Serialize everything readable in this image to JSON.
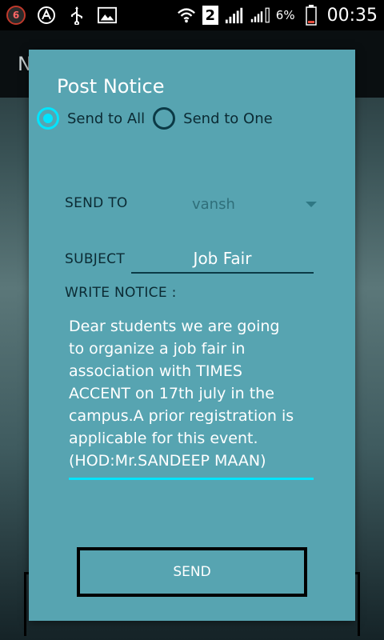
{
  "status_bar": {
    "notification_count": "6",
    "sim_number": "2",
    "battery_percent": "6%",
    "time": "00:35",
    "icons": [
      "notification-badge",
      "a-logo-icon",
      "usb-icon",
      "image-icon",
      "wifi-icon",
      "sim-icon",
      "signal-icon",
      "signal-icon",
      "battery-icon"
    ]
  },
  "background_app": {
    "title_initial": "N"
  },
  "dialog": {
    "title": "Post Notice",
    "radio_options": [
      {
        "label": "Send to All",
        "selected": true
      },
      {
        "label": "Send to One",
        "selected": false
      }
    ],
    "send_to_label": "SEND TO",
    "send_to_value": "vansh",
    "subject_label": "SUBJECT",
    "subject_value": "Job Fair",
    "notice_label": "WRITE NOTICE :",
    "notice_text": "Dear students we are going\nto organize a job fair in\nassociation with TIMES\nACCENT on 17th july in the\ncampus.A prior registration is\napplicable for this event.\n(HOD:Mr.SANDEEP MAAN)",
    "send_button": "SEND"
  },
  "colors": {
    "dialog_bg": "#57a4b1",
    "accent": "#00e5ff",
    "dark_text": "#0b2a33"
  }
}
